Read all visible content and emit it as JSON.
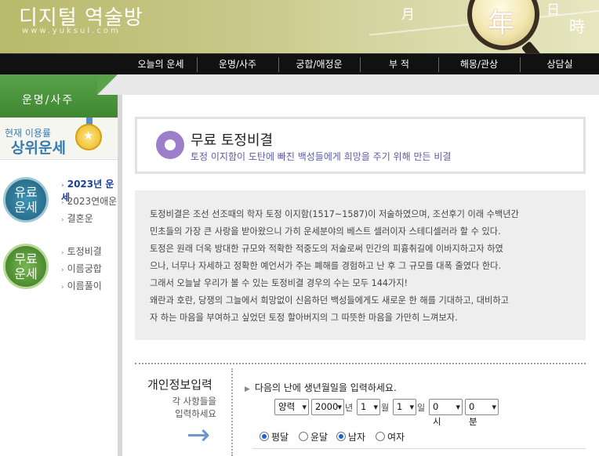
{
  "header": {
    "logo_title": "디지털 역술방",
    "logo_url": "www.yuksul.com",
    "deco_chars": {
      "moon": "月",
      "year": "年",
      "sun": "日",
      "time": "時"
    }
  },
  "nav": {
    "items": [
      "오늘의 운세",
      "운명/사주",
      "궁합/애정운",
      "부 적",
      "해몽/관상",
      "상담실"
    ]
  },
  "sidebar": {
    "section_label": "운명/사주",
    "rank": {
      "line1": "현재 이용률",
      "line2": "상위운세",
      "medal": "★"
    },
    "group1": {
      "circle": "유료\n운세",
      "links": [
        "2023년 운세",
        "2023연애운",
        "결혼운"
      ]
    },
    "group2": {
      "circle": "무료\n운세",
      "links": [
        "토정비결",
        "이름궁합",
        "이름풀이"
      ]
    }
  },
  "title": {
    "heading": "무료 토정비결",
    "subtitle": "토정 이지함이 도탄에 빠진 백성들에게 희망을 주기 위해 만든 비결"
  },
  "description": [
    "토정비결은 조선 선조때의 학자 토정 이지함(1517~1587)이 저술하였으며, 조선후기 이래 수백년간",
    "민초들의 가장 큰 사랑을 받아왔으니 가히 운세분야의 베스트 셀러이자 스테디셀러라 할 수 있다.",
    "토정은 원래 더욱 방대한 규모와 적확한 적중도의 저술로써 민간의 피흉취길에 이바지하고자 하였",
    "으나, 너무나 자세하고 정확한 예언서가 주는 폐해를 경험하고 난 후 그 규모를 대폭 줄였다 한다.",
    "그래서 오늘날 우리가 볼 수 있는 토정비결 경우의 수는 모두 144가지!",
    "왜란과 호란, 당쟁의 그늘에서 희망없이 신음하던 백성들에게도 새로운 한 해를 기대하고, 대비하고",
    "자 하는 마음을 부여하고 싶었던 토정 할아버지의 그 따뜻한 마음을 가만히 느껴보자."
  ],
  "personal": {
    "title": "개인정보입력",
    "subtitle_lines": [
      "각 사항들을",
      "입력하세요"
    ],
    "arrow": "→",
    "prompt": "다음의 난에 생년월일을 입력하세요.",
    "calendar_type": "양력",
    "year": "2000",
    "year_unit": "년",
    "month": "1",
    "month_unit": "월",
    "day": "1",
    "day_unit": "일",
    "hour": "0 시",
    "minute": "0 분",
    "leap_options": [
      "평달",
      "윤달"
    ],
    "leap_selected": "평달",
    "gender_options": [
      "남자",
      "여자"
    ],
    "gender_selected": "남자"
  }
}
